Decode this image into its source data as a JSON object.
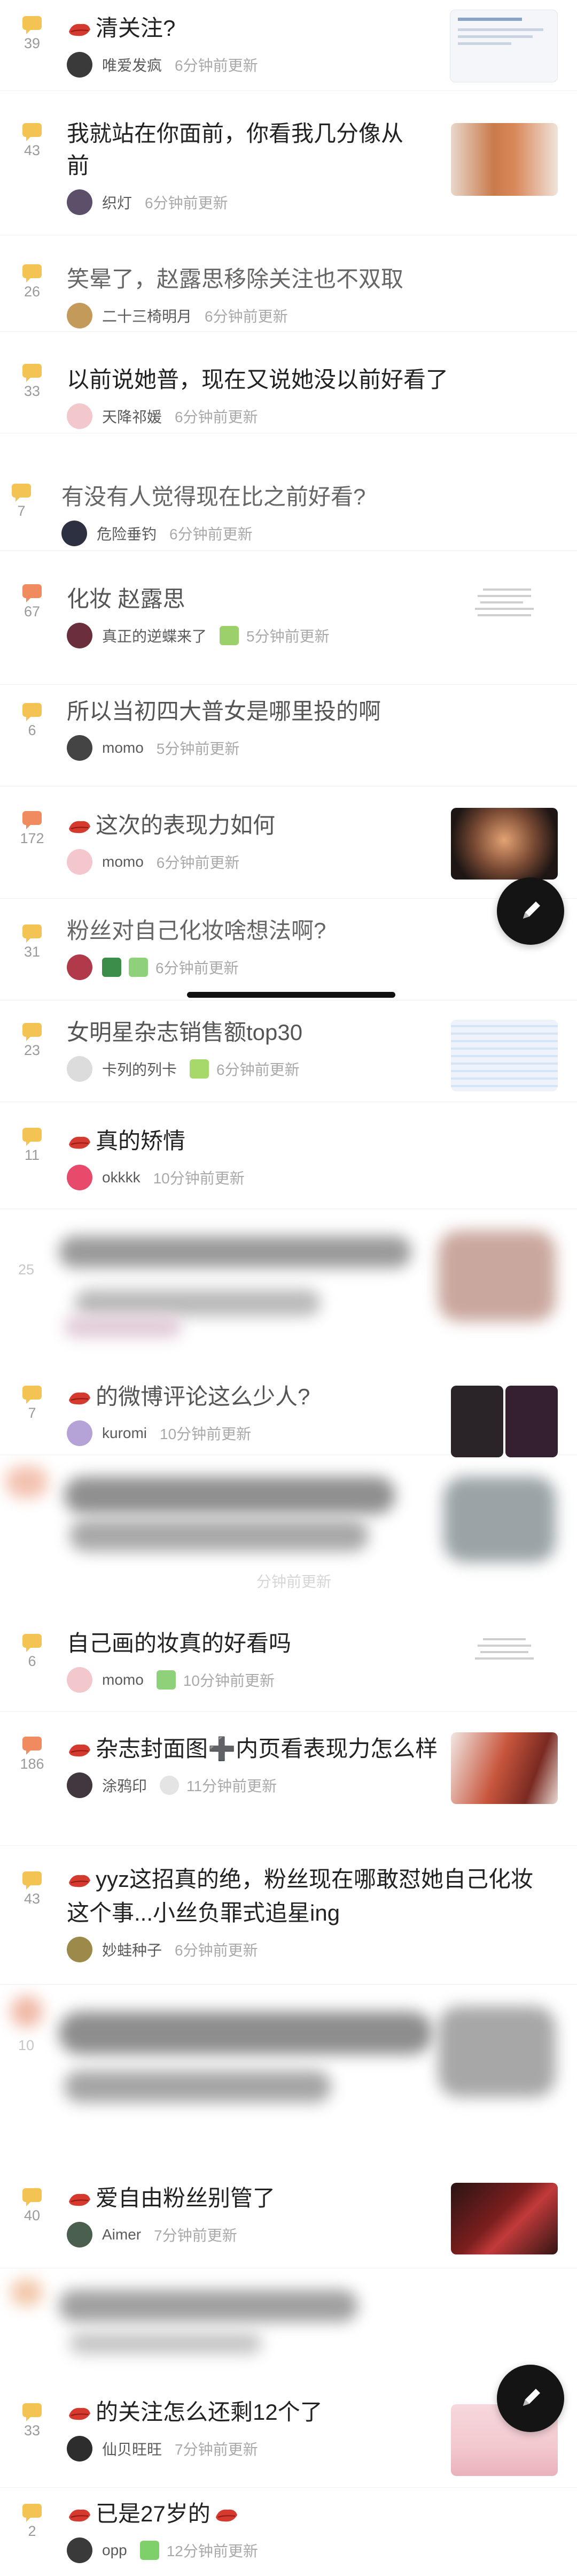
{
  "posts": [
    {
      "title": "清关注?",
      "lead_emoji": true,
      "replies": "39",
      "author": "唯爱发疯",
      "time": "6分钟前更新"
    },
    {
      "title": "我就站在你面前，你看我几分像从前",
      "lead_emoji": false,
      "replies": "43",
      "author": "织灯",
      "time": "6分钟前更新"
    },
    {
      "title": "笑晕了，赵露思移除关注也不双取",
      "lead_emoji": false,
      "replies": "26",
      "author": "二十三椅明月",
      "time": "6分钟前更新"
    },
    {
      "title": "以前说她普，现在又说她没以前好看了",
      "lead_emoji": false,
      "replies": "33",
      "author": "天降祁媛",
      "time": "6分钟前更新"
    },
    {
      "title": "有没有人觉得现在比之前好看?",
      "lead_emoji": false,
      "replies": "7",
      "author": "危险垂钓",
      "time": "6分钟前更新"
    },
    {
      "title": "化妆 赵露思",
      "lead_emoji": false,
      "replies": "67",
      "author": "真正的逆蝶来了",
      "time": "5分钟前更新"
    },
    {
      "title": "所以当初四大普女是哪里投的啊",
      "lead_emoji": false,
      "replies": "6",
      "author": "momo",
      "time": "5分钟前更新"
    },
    {
      "title": "这次的表现力如何",
      "lead_emoji": true,
      "replies": "172",
      "author": "momo",
      "time": "6分钟前更新"
    },
    {
      "title": "粉丝对自己化妆啥想法啊?",
      "lead_emoji": false,
      "replies": "31",
      "author": "",
      "time": "6分钟前更新"
    },
    {
      "title": "女明星杂志销售额top30",
      "lead_emoji": false,
      "replies": "23",
      "author": "卡列的列卡",
      "time": "6分钟前更新"
    },
    {
      "title": "真的矫情",
      "lead_emoji": true,
      "replies": "11",
      "author": "okkkk",
      "time": "10分钟前更新"
    },
    {
      "title": "的微博评论这么少人?",
      "lead_emoji": true,
      "replies": "7",
      "author": "kuromi",
      "time": "10分钟前更新"
    },
    {
      "title": "自己画的妆真的好看吗",
      "lead_emoji": false,
      "replies": "6",
      "author": "momo",
      "time": "10分钟前更新"
    },
    {
      "title": "杂志封面图➕内页看表现力怎么样",
      "lead_emoji": true,
      "replies": "186",
      "author": "涂鸦印",
      "time": "11分钟前更新"
    },
    {
      "title": "yyz这招真的绝，粉丝现在哪敢怼她自己化妆这个事...小丝负罪式追星ing",
      "lead_emoji": true,
      "replies": "43",
      "author": "妙蛙种子",
      "time": "6分钟前更新"
    },
    {
      "title": "爱自由粉丝别管了",
      "lead_emoji": true,
      "replies": "40",
      "author": "Aimer",
      "time": "7分钟前更新"
    },
    {
      "title": "的关注怎么还剩12个了",
      "lead_emoji": true,
      "replies": "33",
      "author": "仙贝旺旺",
      "time": "7分钟前更新"
    },
    {
      "title": "已是27岁的",
      "lead_emoji": true,
      "replies": "2",
      "author": "opp",
      "time": "12分钟前更新"
    }
  ],
  "blurred": {
    "count_1": "25",
    "count_2": "10",
    "faint_time": "分钟前更新"
  },
  "icons": {
    "fab": "pencil-icon",
    "reply": "chat-bubble-icon",
    "emoji": "lipstick-icon"
  },
  "colors": {
    "bubble": "#f3c454",
    "bubble_hot": "#f08b5f",
    "fab": "#141414"
  }
}
